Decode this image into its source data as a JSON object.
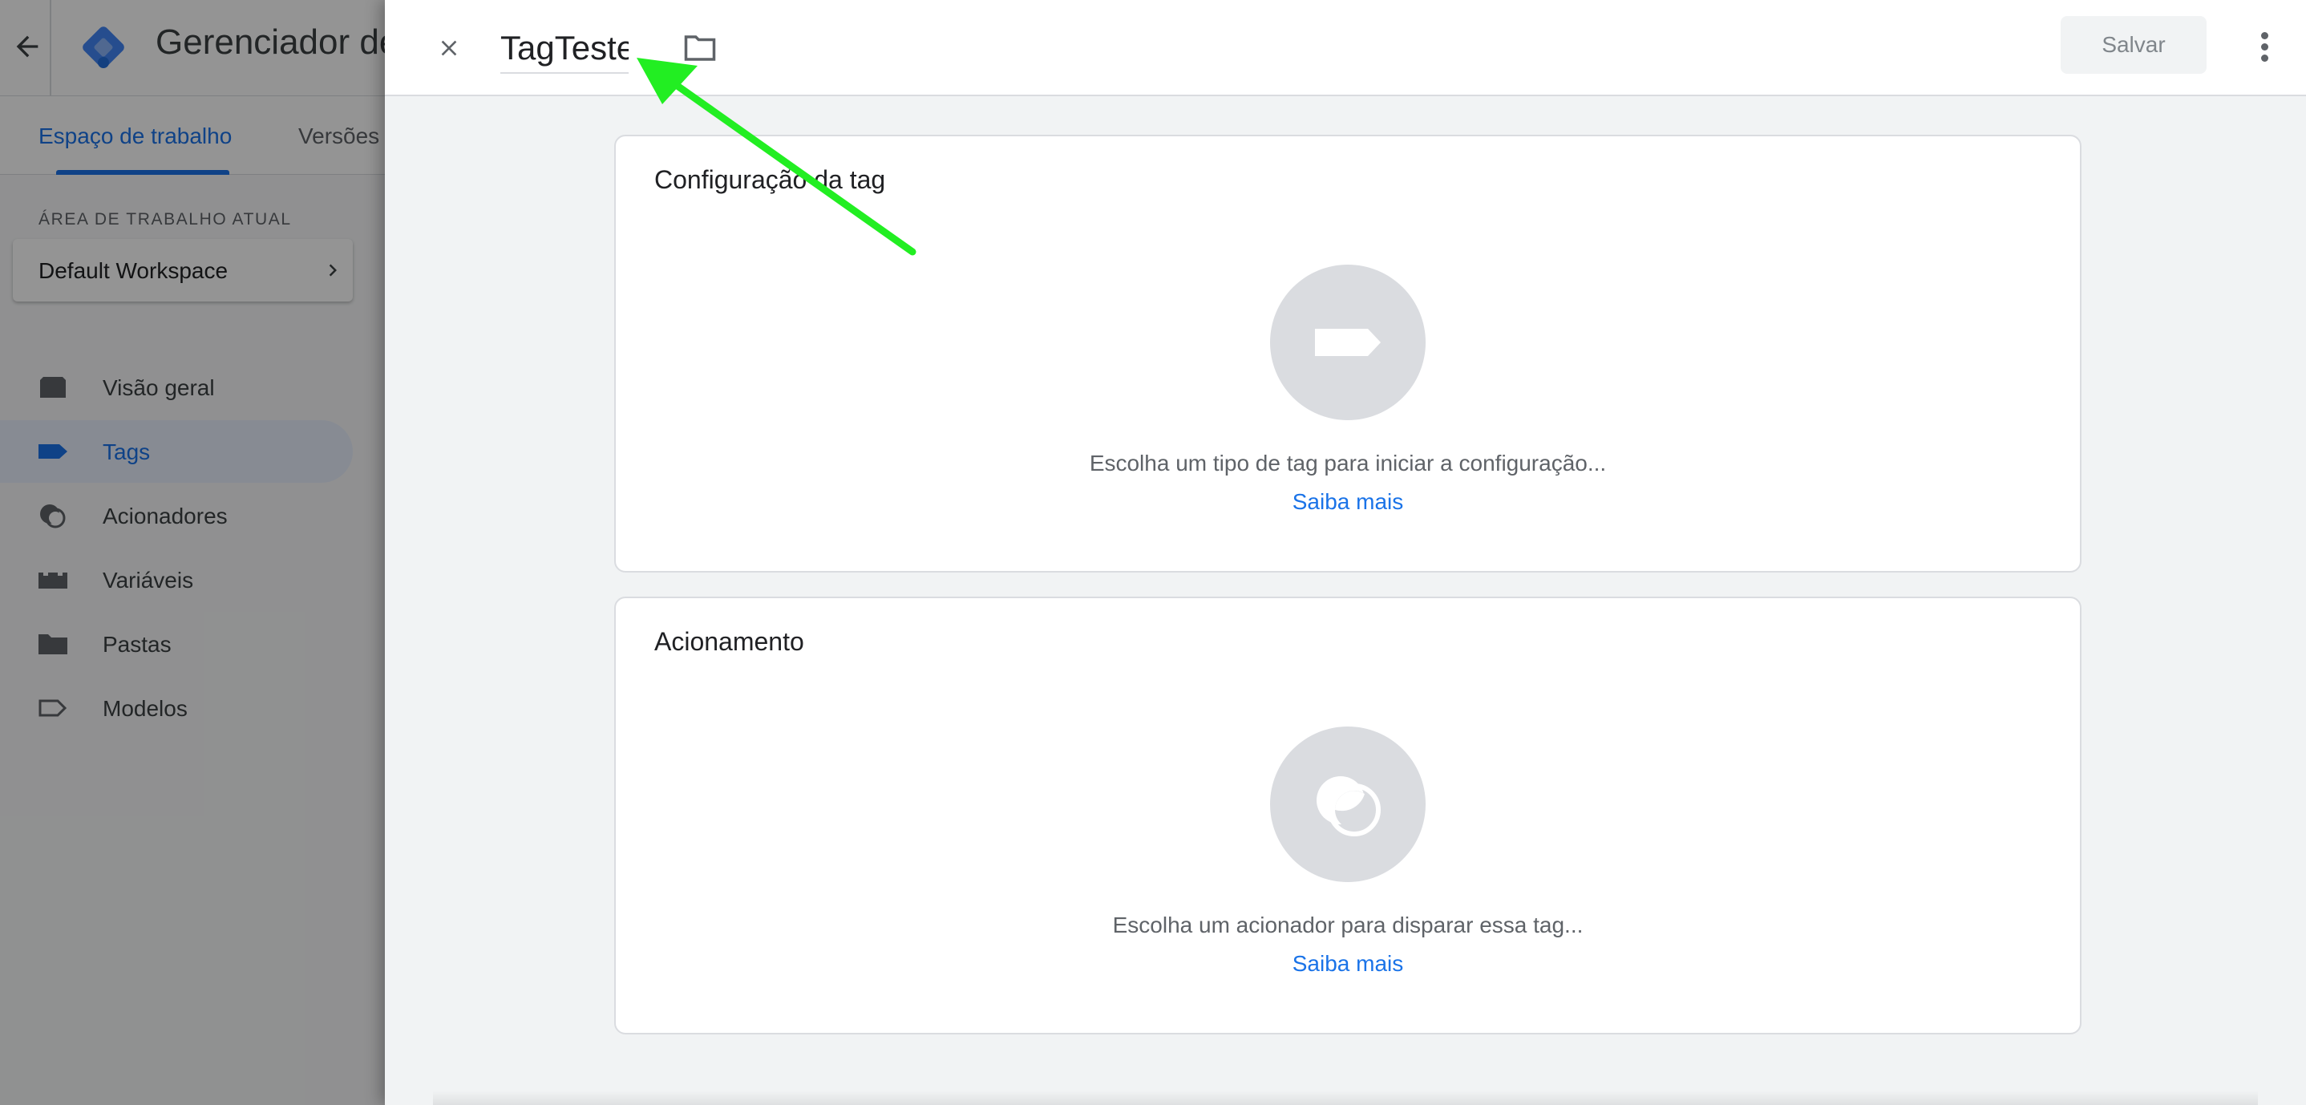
{
  "background_app": {
    "title": "Gerenciador de",
    "tabs": [
      {
        "label": "Espaço de trabalho",
        "active": true
      },
      {
        "label": "Versões",
        "active": false
      }
    ],
    "workspace_section_label": "ÁREA DE TRABALHO ATUAL",
    "workspace_name": "Default Workspace",
    "nav": [
      {
        "label": "Visão geral",
        "icon": "overview-icon",
        "active": false
      },
      {
        "label": "Tags",
        "icon": "tag-icon",
        "active": true
      },
      {
        "label": "Acionadores",
        "icon": "trigger-icon",
        "active": false
      },
      {
        "label": "Variáveis",
        "icon": "variables-icon",
        "active": false
      },
      {
        "label": "Pastas",
        "icon": "folder-icon",
        "active": false
      },
      {
        "label": "Modelos",
        "icon": "template-icon",
        "active": false
      }
    ]
  },
  "sheet": {
    "tag_name_value": "TagTeste",
    "save_label": "Salvar",
    "config_card": {
      "title": "Configuração da tag",
      "hint": "Escolha um tipo de tag para iniciar a configuração...",
      "link": "Saiba mais",
      "icon": "tag-icon"
    },
    "trigger_card": {
      "title": "Acionamento",
      "hint": "Escolha um acionador para disparar essa tag...",
      "link": "Saiba mais",
      "icon": "trigger-icon"
    }
  },
  "colors": {
    "accent": "#1a73e8",
    "annotation_arrow": "#22ee22"
  }
}
